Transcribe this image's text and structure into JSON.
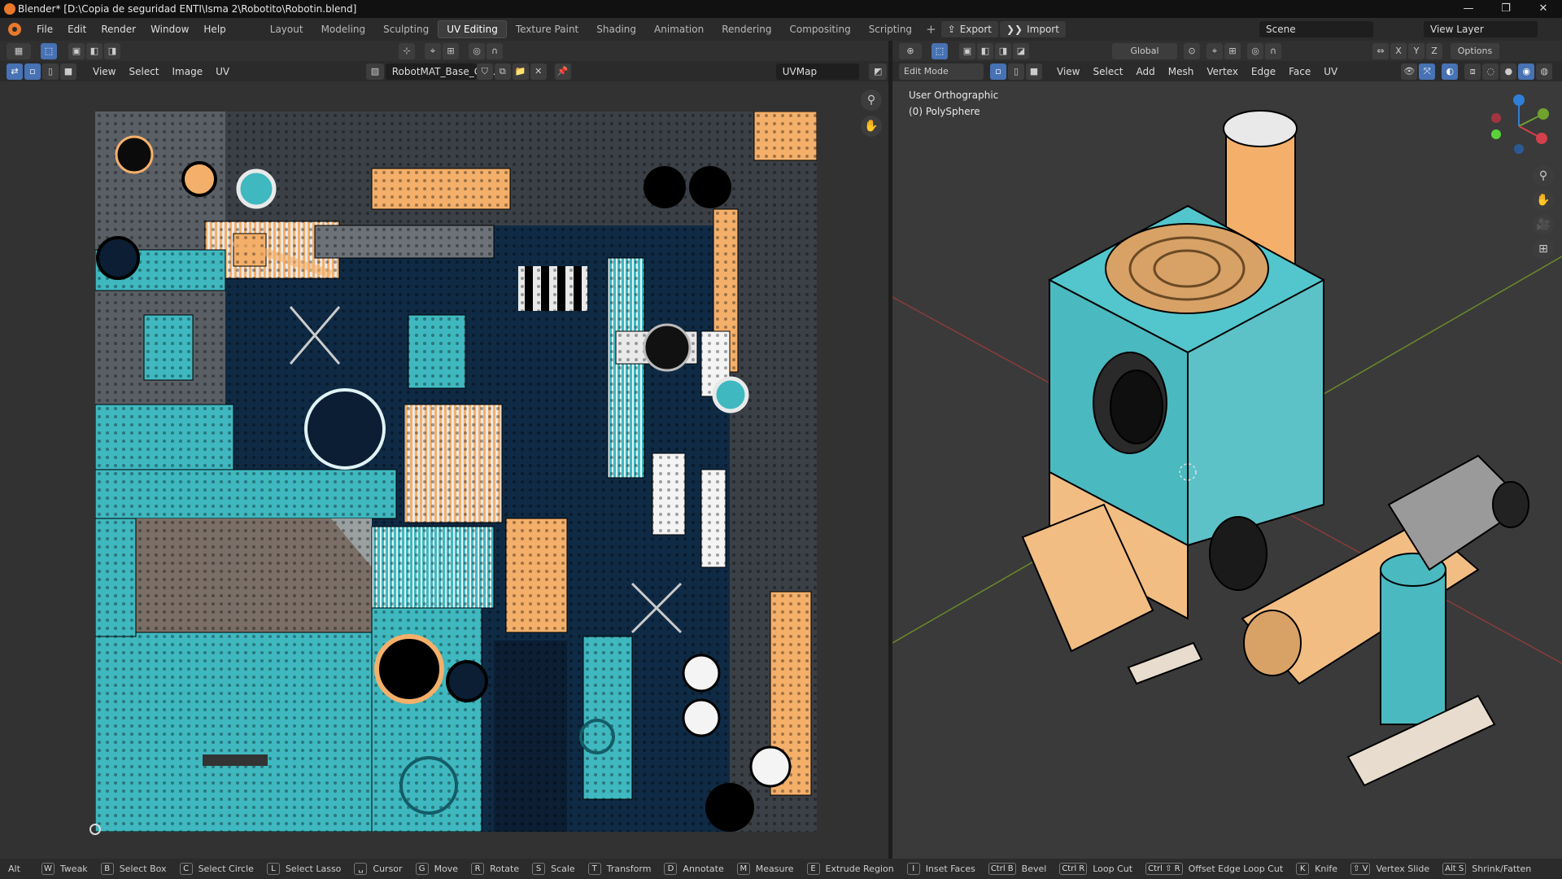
{
  "title": "Blender* [D:\\Copia de seguridad ENTI\\Isma 2\\Robotito\\Robotin.blend]",
  "menus": [
    "File",
    "Edit",
    "Render",
    "Window",
    "Help"
  ],
  "workspaces": [
    "Layout",
    "Modeling",
    "Sculpting",
    "UV Editing",
    "Texture Paint",
    "Shading",
    "Animation",
    "Rendering",
    "Compositing",
    "Scripting"
  ],
  "active_workspace": "UV Editing",
  "export_label": "Export",
  "import_label": "Import",
  "scene": "Scene",
  "view_layer": "View Layer",
  "uv_editor": {
    "menus": [
      "View",
      "Select",
      "Image",
      "UV"
    ],
    "image_name": "RobotMAT_Base_Col...",
    "uv_map": "UVMap"
  },
  "viewport": {
    "mode": "Edit Mode",
    "menus": [
      "View",
      "Select",
      "Add",
      "Mesh",
      "Vertex",
      "Edge",
      "Face",
      "UV"
    ],
    "transform": "Global",
    "options": "Options",
    "view_label": "User Orthographic",
    "object_label": "(0) PolySphere",
    "axes": [
      "X",
      "Y",
      "Z"
    ]
  },
  "statusbar": [
    {
      "key": "Alt",
      "label": ""
    },
    {
      "key": "W",
      "label": "Tweak"
    },
    {
      "key": "B",
      "label": "Select Box"
    },
    {
      "key": "C",
      "label": "Select Circle"
    },
    {
      "key": "L",
      "label": "Select Lasso"
    },
    {
      "key": "␣",
      "label": "Cursor"
    },
    {
      "key": "G",
      "label": "Move"
    },
    {
      "key": "R",
      "label": "Rotate"
    },
    {
      "key": "S",
      "label": "Scale"
    },
    {
      "key": "T",
      "label": "Transform"
    },
    {
      "key": "D",
      "label": "Annotate"
    },
    {
      "key": "M",
      "label": "Measure"
    },
    {
      "key": "E",
      "label": "Extrude Region"
    },
    {
      "key": "I",
      "label": "Inset Faces"
    },
    {
      "key": "Ctrl B",
      "label": "Bevel"
    },
    {
      "key": "Ctrl R",
      "label": "Loop Cut"
    },
    {
      "key": "Ctrl ⇧ R",
      "label": "Offset Edge Loop Cut"
    },
    {
      "key": "K",
      "label": "Knife"
    },
    {
      "key": "⇧ V",
      "label": "Vertex Slide"
    },
    {
      "key": "Alt S",
      "label": "Shrink/Fatten"
    }
  ],
  "colors": {
    "teal": "#3fb8c0",
    "orange": "#f4b06a",
    "navy": "#0f2a44",
    "grey": "#5a5f66",
    "select": "#4772b3"
  }
}
